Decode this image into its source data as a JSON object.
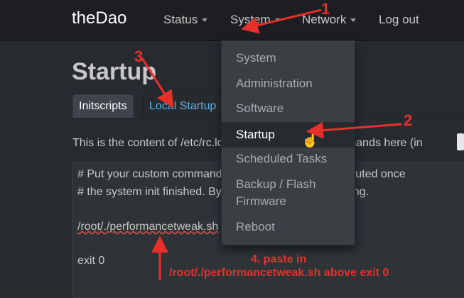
{
  "navbar": {
    "brand": "theDao",
    "items": [
      {
        "label": "Status"
      },
      {
        "label": "System"
      },
      {
        "label": "Network"
      },
      {
        "label": "Log out"
      }
    ]
  },
  "page": {
    "title": "Startup",
    "tabs": [
      "Initscripts",
      "Local Startup"
    ],
    "description": "This is the content of /etc/rc.local. Insert your own commands here (in",
    "editor_lines": [
      "# Put your custom commands here that should be executed once",
      "# the system init finished. By default this file does nothing.",
      "",
      "/root/./performancetweak.sh",
      "",
      "exit 0"
    ]
  },
  "dropdown": {
    "items": [
      "System",
      "Administration",
      "Software",
      "Startup",
      "Scheduled Tasks",
      "Backup / Flash",
      "Firmware",
      "Reboot"
    ],
    "active": "Startup"
  },
  "annotations": {
    "n1": "1",
    "n2": "2",
    "n3": "3",
    "n4_line1": "4. paste in",
    "n4_line2": "/root/./performancetweak.sh above exit 0"
  },
  "colors": {
    "accent": "#e8302b",
    "link": "#5fb0e0"
  }
}
